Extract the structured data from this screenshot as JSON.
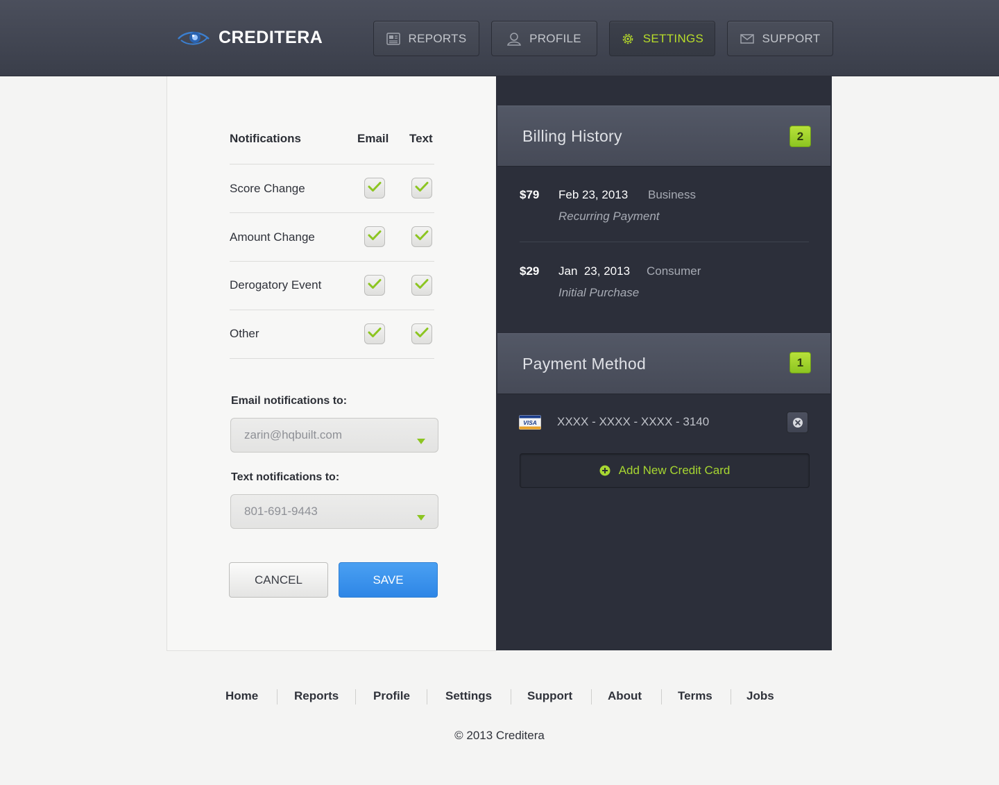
{
  "header": {
    "brand": "CREDITERA",
    "nav": [
      {
        "label": "REPORTS",
        "icon": "document-icon",
        "active": false
      },
      {
        "label": "PROFILE",
        "icon": "user-icon",
        "active": false
      },
      {
        "label": "SETTINGS",
        "icon": "gear-icon",
        "active": true
      },
      {
        "label": "SUPPORT",
        "icon": "envelope-icon",
        "active": false
      }
    ]
  },
  "notifications": {
    "col_label": "Notifications",
    "col_email": "Email",
    "col_text": "Text",
    "rows": [
      {
        "label": "Score Change",
        "email": true,
        "text": true
      },
      {
        "label": "Amount Change",
        "email": true,
        "text": true
      },
      {
        "label": "Derogatory Event",
        "email": true,
        "text": true
      },
      {
        "label": "Other",
        "email": true,
        "text": true
      }
    ]
  },
  "email_field": {
    "label": "Email notifications to:",
    "value": "zarin@hqbuilt.com"
  },
  "text_field": {
    "label": "Text notifications to:",
    "value": "801-691-9443"
  },
  "actions": {
    "cancel": "CANCEL",
    "save": "SAVE"
  },
  "billing": {
    "title": "Billing History",
    "count": "2",
    "items": [
      {
        "amount": "$79",
        "date": "Feb 23, 2013",
        "type": "Business",
        "desc": "Recurring Payment"
      },
      {
        "amount": "$29",
        "date": "Jan  23, 2013",
        "type": "Consumer",
        "desc": "Initial Purchase"
      }
    ]
  },
  "payment": {
    "title": "Payment Method",
    "count": "1",
    "card_brand": "VISA",
    "card_number": "XXXX - XXXX - XXXX - 3140",
    "add_label": "Add New Credit Card"
  },
  "footer": {
    "links": [
      "Home",
      "Reports",
      "Profile",
      "Settings",
      "Support",
      "About",
      "Terms",
      "Jobs"
    ],
    "copyright": "© 2013 Creditera"
  },
  "colors": {
    "accent_green": "#b8dd2a",
    "save_blue": "#3a92ec",
    "header_bg": "#434753",
    "dark_panel": "#2c2f3a"
  }
}
